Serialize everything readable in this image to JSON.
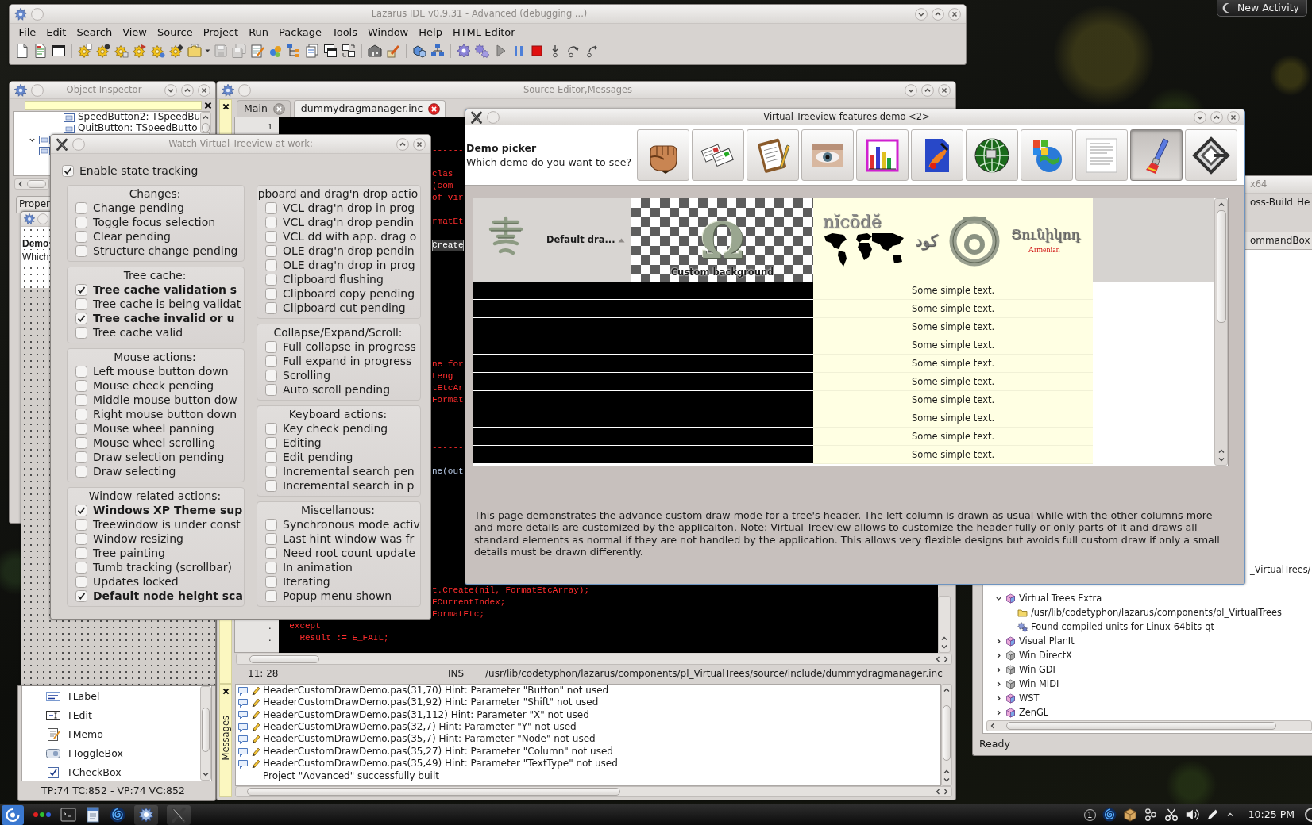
{
  "desktop": {
    "new_activity": "New Activity"
  },
  "ide_main_window": {
    "title": "Lazarus IDE v0.9.31 - Advanced (debugging ...)",
    "menu": [
      "File",
      "Edit",
      "Search",
      "View",
      "Source",
      "Project",
      "Run",
      "Package",
      "Tools",
      "Window",
      "Help",
      "HTML Editor"
    ]
  },
  "object_inspector": {
    "title": "Object Inspector",
    "tree": [
      {
        "kind": "offscreen",
        "children": [
          {
            "kind": "component",
            "label": "SpeedButton2: TSpeedBu"
          },
          {
            "kind": "component",
            "label": "QuitButton: TSpeedButto"
          }
        ]
      },
      {
        "kind": "component",
        "expanded": true
      },
      {
        "kind": "component"
      }
    ],
    "tab": "Proper"
  },
  "form_designer": {
    "heading": "Demo",
    "text": "Which"
  },
  "component_palette": {
    "items": [
      {
        "label": "TLabel",
        "kind": "label"
      },
      {
        "label": "TEdit",
        "kind": "edit"
      },
      {
        "label": "TMemo",
        "kind": "memo"
      },
      {
        "label": "TToggleBox",
        "kind": "toggle"
      },
      {
        "label": "TCheckBox",
        "kind": "checkbox"
      }
    ],
    "status": "TP:74 TC:852 - VP:74 VC:852"
  },
  "source_editor": {
    "title": "Source Editor,Messages",
    "tabs": [
      {
        "label": "Main",
        "selected": false
      },
      {
        "label": "dummydragmanager.inc",
        "selected": true
      }
    ],
    "code_lines": [
      {
        "kind": "blank",
        "gutter": "1"
      },
      {
        "kind": "blank"
      },
      {
        "kind": "edge",
        "text": "------"
      },
      {
        "kind": "blank"
      },
      {
        "kind": "edge",
        "text": "clas"
      },
      {
        "kind": "edge",
        "text": "(com"
      },
      {
        "kind": "edge",
        "text": "of vir"
      },
      {
        "kind": "blank"
      },
      {
        "kind": "edge",
        "text": "rmatEt"
      },
      {
        "kind": "blank"
      },
      {
        "kind": "highlight",
        "text": "Create"
      },
      {
        "kind": "blank"
      },
      {
        "kind": "blank"
      },
      {
        "kind": "blank"
      },
      {
        "kind": "blank"
      },
      {
        "kind": "blank"
      },
      {
        "kind": "blank"
      },
      {
        "kind": "blank"
      },
      {
        "kind": "blank"
      },
      {
        "kind": "blank"
      },
      {
        "kind": "edge",
        "text": "ne for"
      },
      {
        "kind": "edge",
        "text": "Leng"
      },
      {
        "kind": "edge",
        "text": "tEtcAr"
      },
      {
        "kind": "edge",
        "text": "Format"
      },
      {
        "kind": "blank"
      },
      {
        "kind": "blank"
      },
      {
        "kind": "blank"
      },
      {
        "kind": "edge",
        "text": "------"
      },
      {
        "kind": "blank"
      },
      {
        "kind": "plain",
        "text": "ne(out"
      },
      {
        "kind": "blank"
      },
      {
        "kind": "blank"
      },
      {
        "kind": "blank"
      },
      {
        "kind": "blank"
      },
      {
        "kind": "blank"
      },
      {
        "kind": "blank"
      },
      {
        "kind": "blank"
      },
      {
        "kind": "blank"
      },
      {
        "kind": "blank"
      },
      {
        "kind": "edge",
        "text": "t.Create(nil, FormatEtcArray);"
      },
      {
        "kind": "edge",
        "text": "FCurrentIndex;"
      },
      {
        "kind": "edge",
        "text": "FormatEtc;"
      },
      {
        "kind": "block",
        "text": "except",
        "gutter": "."
      },
      {
        "kind": "statement",
        "text": "Result := E_FAIL;",
        "gutter": "."
      }
    ],
    "status": {
      "position": "11: 28",
      "mode": "INS",
      "path": "/usr/lib/codetyphon/lazarus/components/pl_VirtualTrees/source/include/dummydragmanager.inc"
    },
    "messages_label": "Messages",
    "messages": [
      {
        "kind": "hint",
        "text": "HeaderCustomDrawDemo.pas(31,70) Hint: Parameter \"Button\" not used"
      },
      {
        "kind": "hint",
        "text": "HeaderCustomDrawDemo.pas(31,92) Hint: Parameter \"Shift\" not used"
      },
      {
        "kind": "hint",
        "text": "HeaderCustomDrawDemo.pas(31,112) Hint: Parameter \"X\" not used"
      },
      {
        "kind": "hint",
        "text": "HeaderCustomDrawDemo.pas(32,7) Hint: Parameter \"Y\" not used"
      },
      {
        "kind": "hint",
        "text": "HeaderCustomDrawDemo.pas(35,7) Hint: Parameter \"Node\" not used"
      },
      {
        "kind": "hint",
        "text": "HeaderCustomDrawDemo.pas(35,27) Hint: Parameter \"Column\" not used"
      },
      {
        "kind": "hint",
        "text": "HeaderCustomDrawDemo.pas(35,49) Hint: Parameter \"TextType\" not used"
      },
      {
        "kind": "info",
        "text": "Project \"Advanced\" successfully built"
      }
    ]
  },
  "watch_window": {
    "title": "Watch Virtual Treeview at work:",
    "enable": {
      "label": "Enable state tracking",
      "checked": true
    },
    "left_groups": [
      {
        "title": "Changes:",
        "items": [
          {
            "label": "Change pending",
            "checked": false
          },
          {
            "label": "Toggle focus selection",
            "checked": false
          },
          {
            "label": "Clear pending",
            "checked": false
          },
          {
            "label": "Structure change pending",
            "checked": false
          }
        ]
      },
      {
        "title": "Tree cache:",
        "items": [
          {
            "label": "Tree cache validation s",
            "checked": true
          },
          {
            "label": "Tree cache is being validat",
            "checked": false
          },
          {
            "label": "Tree cache invalid or u",
            "checked": true
          },
          {
            "label": "Tree cache valid",
            "checked": false
          }
        ]
      },
      {
        "title": "Mouse actions:",
        "items": [
          {
            "label": "Left mouse button down",
            "checked": false
          },
          {
            "label": "Mouse check pending",
            "checked": false
          },
          {
            "label": "Middle mouse button dow",
            "checked": false
          },
          {
            "label": "Right mouse button down",
            "checked": false
          },
          {
            "label": "Mouse wheel panning",
            "checked": false
          },
          {
            "label": "Mouse wheel scrolling",
            "checked": false
          },
          {
            "label": "Draw selection pending",
            "checked": false
          },
          {
            "label": "Draw selecting",
            "checked": false
          }
        ]
      },
      {
        "title": "Window related actions:",
        "items": [
          {
            "label": "Windows XP Theme sup",
            "checked": true
          },
          {
            "label": "Treewindow is under const",
            "checked": false
          },
          {
            "label": "Window resizing",
            "checked": false
          },
          {
            "label": "Tree painting",
            "checked": false
          },
          {
            "label": "Tumb tracking (scrollbar)",
            "checked": false
          },
          {
            "label": "Updates locked",
            "checked": false
          },
          {
            "label": "Default node height sca",
            "checked": true
          }
        ]
      }
    ],
    "right_groups": [
      {
        "title": "pboard and drag'n drop actio",
        "items": [
          {
            "label": "VCL drag'n drop in prog",
            "checked": false
          },
          {
            "label": "VCL drag'n drop pendin",
            "checked": false
          },
          {
            "label": "VCL dd with app. drag o",
            "checked": false
          },
          {
            "label": "OLE drag'n drop pendin",
            "checked": false
          },
          {
            "label": "OLE drag'n drop in prog",
            "checked": false
          },
          {
            "label": "Clipboard flushing",
            "checked": false
          },
          {
            "label": "Clipboard copy pending",
            "checked": false
          },
          {
            "label": "Clipboard cut pending",
            "checked": false
          }
        ]
      },
      {
        "title": "Collapse/Expand/Scroll:",
        "items": [
          {
            "label": "Full collapse in progress",
            "checked": false
          },
          {
            "label": "Full expand in progress",
            "checked": false
          },
          {
            "label": "Scrolling",
            "checked": false
          },
          {
            "label": "Auto scroll pending",
            "checked": false
          }
        ]
      },
      {
        "title": "Keyboard actions:",
        "items": [
          {
            "label": "Key check pending",
            "checked": false
          },
          {
            "label": "Editing",
            "checked": false
          },
          {
            "label": "Edit pending",
            "checked": false
          },
          {
            "label": "Incremental search pen",
            "checked": false
          },
          {
            "label": "Incremental search in p",
            "checked": false
          }
        ]
      },
      {
        "title": "Miscellanous:",
        "items": [
          {
            "label": "Synchronous mode activ",
            "checked": false
          },
          {
            "label": "Last hint window was fr",
            "checked": false
          },
          {
            "label": "Need root count update",
            "checked": false
          },
          {
            "label": "In animation",
            "checked": false
          },
          {
            "label": "Iterating",
            "checked": false
          },
          {
            "label": "Popup menu shown",
            "checked": false
          }
        ]
      }
    ]
  },
  "demo_window": {
    "title": "Virtual Treeview features demo <2>",
    "picker_title": "Demo picker",
    "picker_prompt": "Which demo do you want to see?",
    "demo_buttons": [
      {
        "kind": "fist",
        "selected": false
      },
      {
        "kind": "papers",
        "selected": false
      },
      {
        "kind": "clipboard",
        "selected": false
      },
      {
        "kind": "eye",
        "selected": false
      },
      {
        "kind": "chart",
        "selected": false
      },
      {
        "kind": "paint",
        "selected": false
      },
      {
        "kind": "globe",
        "selected": false
      },
      {
        "kind": "flag",
        "selected": false
      },
      {
        "kind": "page",
        "selected": false
      },
      {
        "kind": "brush",
        "selected": true
      },
      {
        "kind": "logo",
        "selected": false
      }
    ],
    "header_columns": [
      {
        "kind": "emblem",
        "caption": "Default dra...",
        "sorted": true
      },
      {
        "kind": "checker",
        "glyph": "Ω",
        "caption": "Custom background"
      },
      {
        "kind": "unicode",
        "texts": [
          "nĭcōdĕ",
          "كود",
          "Յունիկոդ"
        ],
        "note": "Armenian"
      }
    ],
    "rows": [
      "Some simple text.",
      "Some simple text.",
      "Some simple text.",
      "Some simple text.",
      "Some simple text.",
      "Some simple text.",
      "Some simple text.",
      "Some simple text.",
      "Some simple text.",
      "Some simple text."
    ],
    "description": "This page demonstrates the advance custom draw mode for a tree's header. The left column is drawn as usual while with the other columns more and more details are customized by the applicaiton. Note: Virtual Treeview allows to customize the header fully or only parts of it and draws all standard elements as normal if they are not handled by the application. This allows very flexible designs but avoids full custom draw if only a small details must be drawn differently."
  },
  "background_window": {
    "title": "x64",
    "menu": [
      "oss-Build",
      "He"
    ],
    "tab": "ommandBox",
    "tree_fragment": "_VirtualTrees/",
    "tree": [
      {
        "label": "Virtual Trees Extra",
        "kind": "package",
        "expanded": true,
        "children": [
          {
            "label": "/usr/lib/codetyphon/lazarus/components/pl_VirtualTrees",
            "kind": "folder"
          },
          {
            "label": "Found compiled units for Linux-64bits-qt",
            "kind": "units"
          }
        ]
      },
      {
        "label": "Visual PlanIt",
        "kind": "package",
        "expanded": false
      },
      {
        "label": "Win DirectX",
        "kind": "grey",
        "expanded": false
      },
      {
        "label": "Win GDI",
        "kind": "grey",
        "expanded": false
      },
      {
        "label": "Win MIDI",
        "kind": "grey",
        "expanded": false
      },
      {
        "label": "WST",
        "kind": "package",
        "expanded": false
      },
      {
        "label": "ZenGL",
        "kind": "package",
        "expanded": false
      }
    ],
    "status": "Ready"
  },
  "taskbar": {
    "workspace": "1",
    "clock": "10:25 PM"
  }
}
